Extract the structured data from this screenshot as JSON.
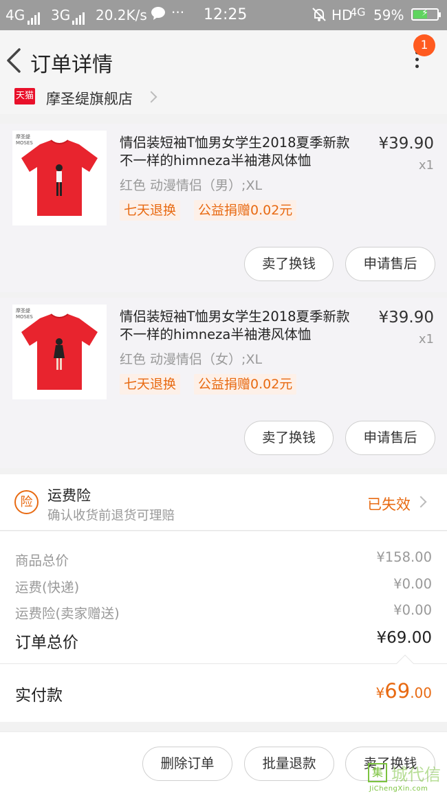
{
  "status_bar": {
    "net1": "4G",
    "net2": "3G",
    "speed": "20.2K/s",
    "dots": "···",
    "time": "12:25",
    "hd": "HD",
    "net3": "4G",
    "battery": "59%",
    "battery_level": 0.59
  },
  "header": {
    "title": "订单详情",
    "badge_count": "1"
  },
  "shop": {
    "badge": "天猫",
    "name": "摩圣缇旗舰店"
  },
  "items": [
    {
      "brand": "摩圣缇",
      "brand_en": "MOSES",
      "title": "情侣装短袖T恤男女学生2018夏季新款不一样的himneza半袖港风体恤",
      "price": "¥39.90",
      "qty": "x1",
      "spec": "红色  动漫情侣（男）;XL",
      "tag1": "七天退换",
      "tag2": "公益捐赠0.02元",
      "btn1": "卖了换钱",
      "btn2": "申请售后"
    },
    {
      "brand": "摩圣缇",
      "brand_en": "MOSES",
      "title": "情侣装短袖T恤男女学生2018夏季新款不一样的himneza半袖港风体恤",
      "price": "¥39.90",
      "qty": "x1",
      "spec": "红色  动漫情侣（女）;XL",
      "tag1": "七天退换",
      "tag2": "公益捐赠0.02元",
      "btn1": "卖了换钱",
      "btn2": "申请售后"
    }
  ],
  "insurance": {
    "icon_char": "险",
    "title": "运费险",
    "subtitle": "确认收货前退货可理赔",
    "status": "已失效"
  },
  "summary": {
    "rows": [
      {
        "label": "商品总价",
        "value": "¥158.00"
      },
      {
        "label": "运费(快递)",
        "value": "¥0.00"
      },
      {
        "label": "运费险(卖家赠送)",
        "value": "¥0.00"
      }
    ],
    "total_label": "订单总价",
    "total_value": "¥69.00",
    "paid_label": "实付款",
    "paid_currency": "¥",
    "paid_int": "69",
    "paid_dec": ".00"
  },
  "bottom_bar": {
    "delete": "删除订单",
    "batch_refund": "批量退款",
    "sell": "卖了换钱"
  },
  "watermark": {
    "box": "集",
    "text": "城代信",
    "url": "JiChengXin.com"
  },
  "colors": {
    "accent": "#e86a12",
    "badge": "#ff5a1f",
    "tmall": "#e9102a",
    "shirt": "#e8242e"
  }
}
